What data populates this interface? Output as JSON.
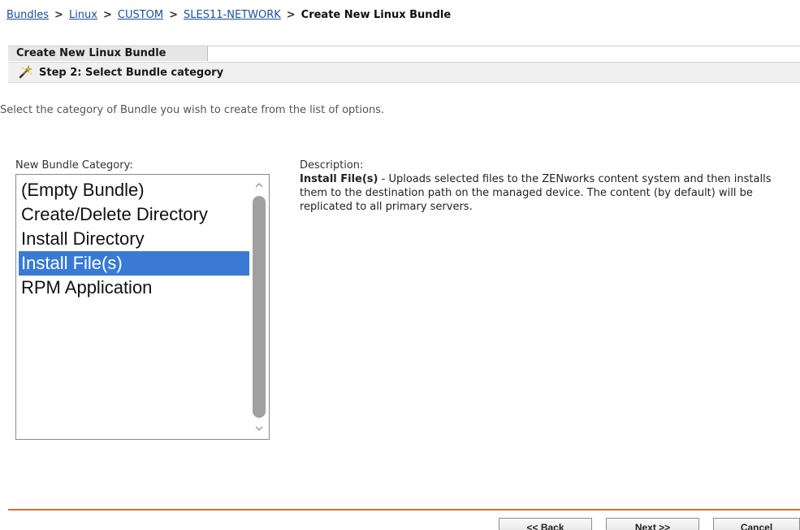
{
  "breadcrumb": {
    "items": [
      "Bundles",
      "Linux",
      "CUSTOM",
      "SLES11-NETWORK"
    ],
    "separator": ">",
    "current": "Create New Linux Bundle"
  },
  "header": {
    "tab_title": "Create New Linux Bundle",
    "step_label": "Step 2: Select Bundle category",
    "step_icon": "magic-wand-icon"
  },
  "instruction": "Select the category of Bundle you wish to create from the list of options.",
  "category_list": {
    "label": "New Bundle Category:",
    "items": [
      "(Empty Bundle)",
      "Create/Delete Directory",
      "Install Directory",
      "Install File(s)",
      "RPM Application"
    ],
    "selected": "Install File(s)"
  },
  "description": {
    "label": "Description:",
    "title": "Install File(s)",
    "text": " - Uploads selected files to the ZENworks content system and then installs them to the destination path on the managed device. The content (by default) will be replicated to all primary servers."
  },
  "buttons": {
    "back": "<< Back",
    "next": "Next >>",
    "cancel": "Cancel"
  },
  "colors": {
    "link": "#1a4fa3",
    "selection": "#3a7ad5",
    "footer_rule": "#e2692b"
  }
}
